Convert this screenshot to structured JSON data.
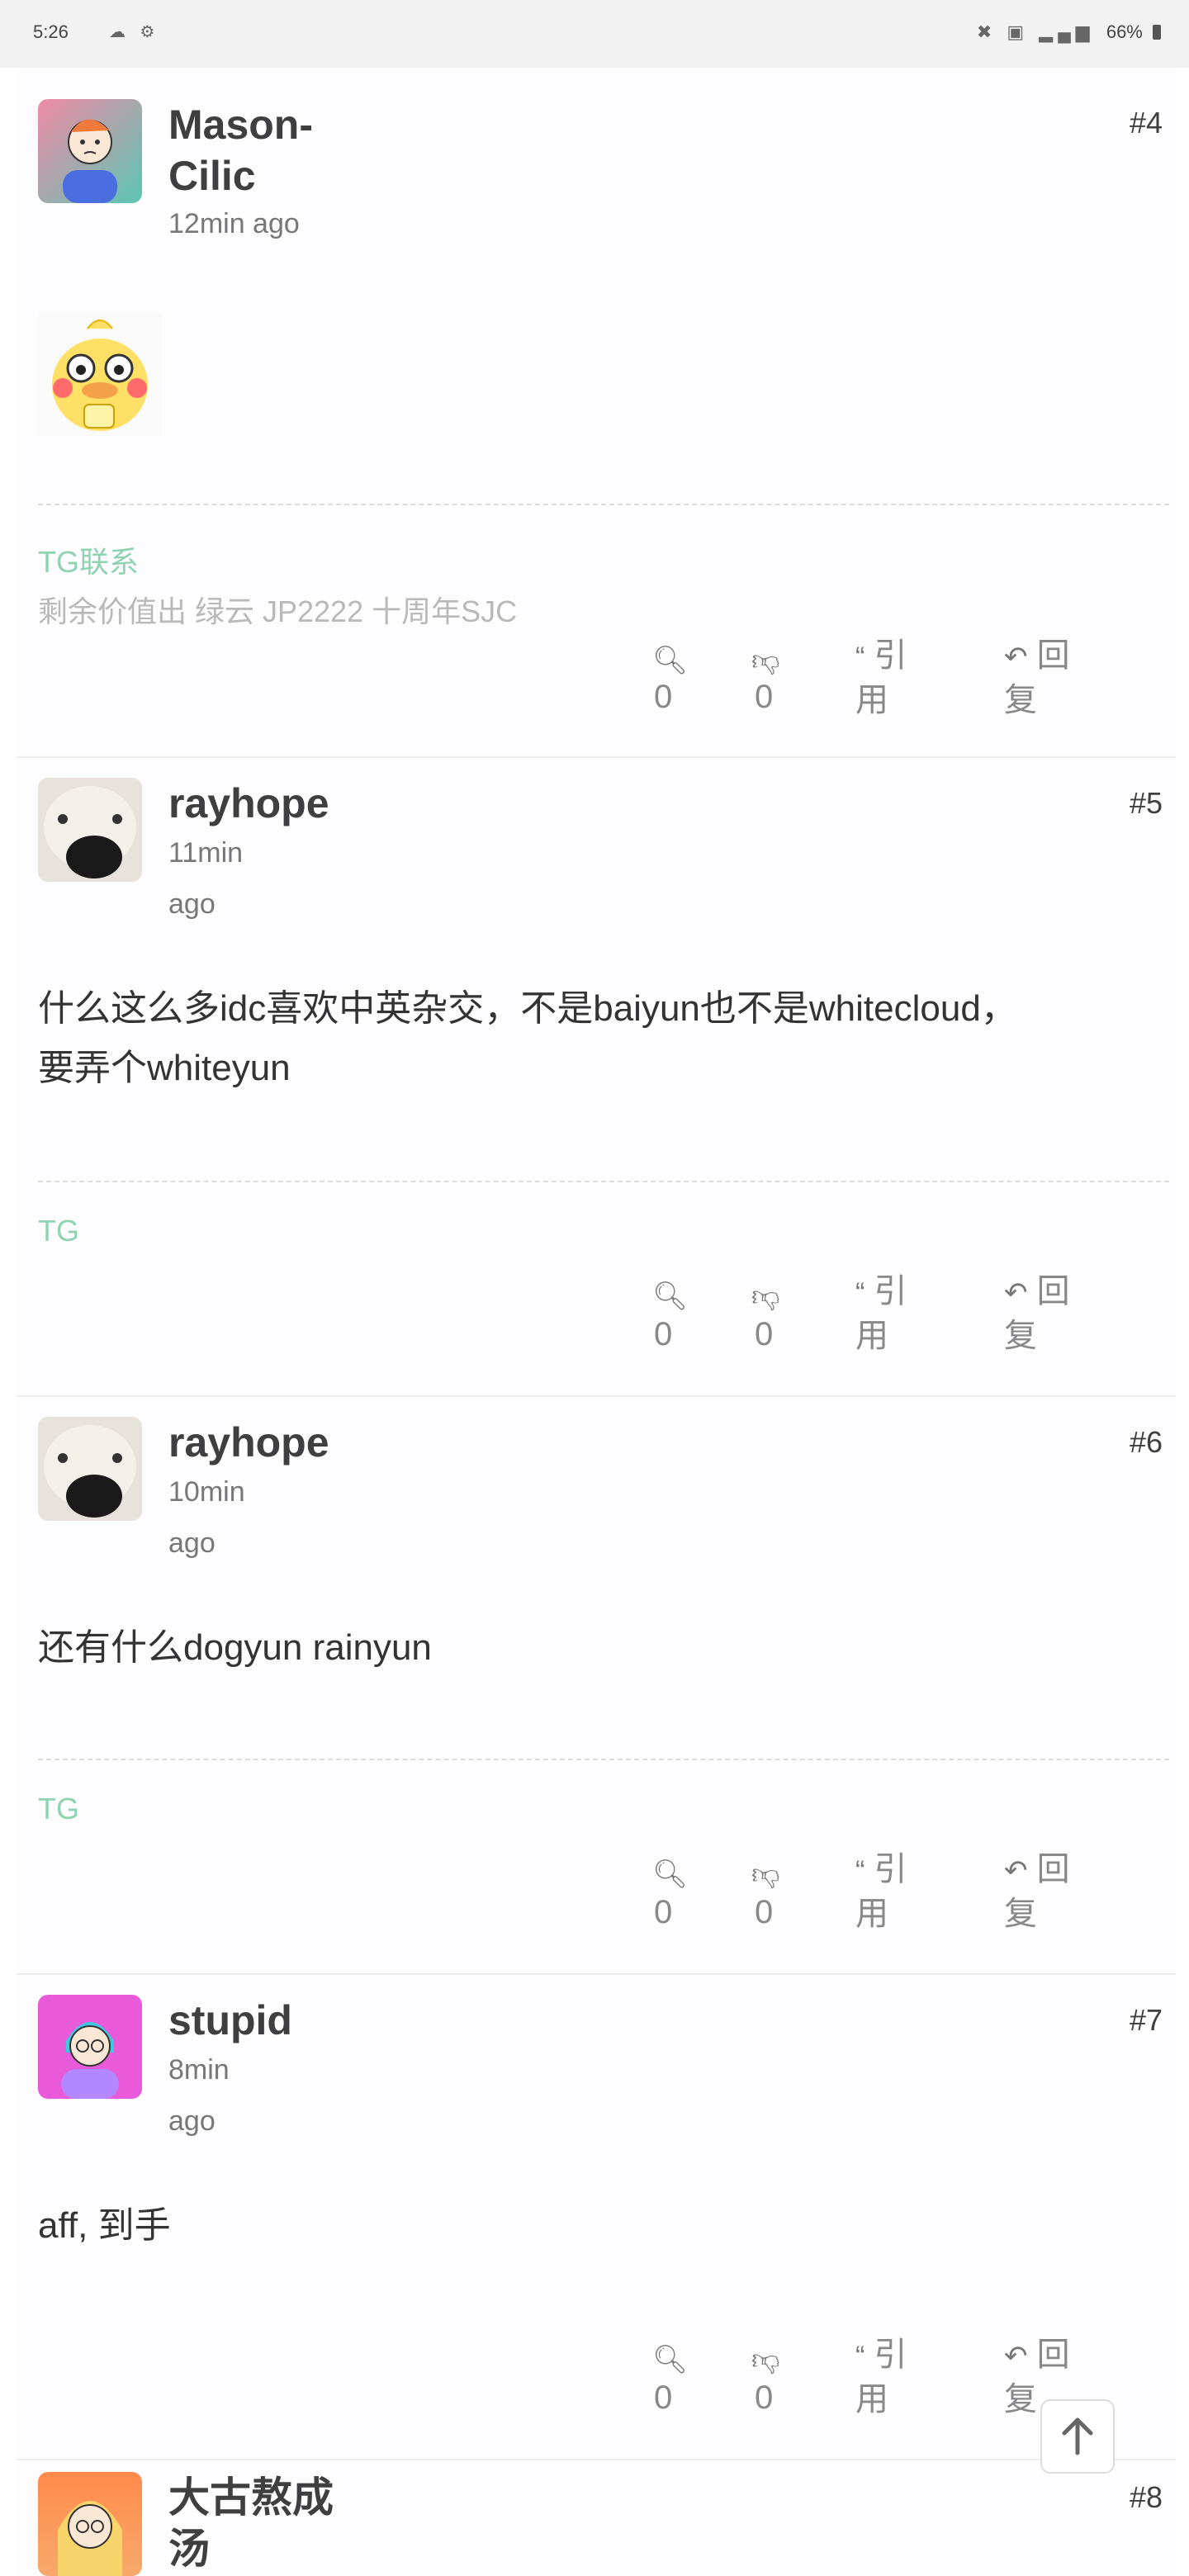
{
  "status_bar": {
    "time": "5:26",
    "left_icons": "☁ ⚙",
    "right_icons": "✖ ▣ ▂▄▆",
    "battery": "66%"
  },
  "posts": [
    {
      "username": "Mason-Cilic",
      "username_line1": "Mason-",
      "username_line2": "Cilic",
      "time": "12min ago",
      "floor": "#4",
      "signature_tg": "TG联系",
      "signature_text": "剩余价值出 绿云 JP2222 十周年SJC",
      "actions": {
        "views": "0",
        "dislikes": "0",
        "quote_1": "引",
        "quote_2": "用",
        "reply_1": "回",
        "reply_2": "复"
      }
    },
    {
      "username": "rayhope",
      "time_1": "11min",
      "time_2": "ago",
      "floor": "#5",
      "content_line1": "什么这么多idc喜欢中英杂交，不是baiyun也不是whitecloud，",
      "content_line2": "要弄个whiteyun",
      "signature_tg": "TG",
      "actions": {
        "views": "0",
        "dislikes": "0",
        "quote_1": "引",
        "quote_2": "用",
        "reply_1": "回",
        "reply_2": "复"
      }
    },
    {
      "username": "rayhope",
      "time_1": "10min",
      "time_2": "ago",
      "floor": "#6",
      "content": "还有什么dogyun rainyun",
      "signature_tg": "TG",
      "actions": {
        "views": "0",
        "dislikes": "0",
        "quote_1": "引",
        "quote_2": "用",
        "reply_1": "回",
        "reply_2": "复"
      }
    },
    {
      "username": "stupid",
      "time_1": "8min",
      "time_2": "ago",
      "floor": "#7",
      "content": "aff, 到手",
      "actions": {
        "views": "0",
        "dislikes": "0",
        "quote_1": "引",
        "quote_2": "用",
        "reply_1": "回",
        "reply_2": "复"
      }
    },
    {
      "username_line1": "大古熬成",
      "username_line2": "汤",
      "floor": "#8"
    }
  ],
  "colors": {
    "signature_green": "#8fd3b1",
    "text_dark": "#3f3f3f",
    "muted": "#888888"
  },
  "icons": [
    "search-zoom-icon",
    "thumbs-down-icon",
    "quote-icon",
    "reply-icon",
    "arrow-up-icon"
  ]
}
